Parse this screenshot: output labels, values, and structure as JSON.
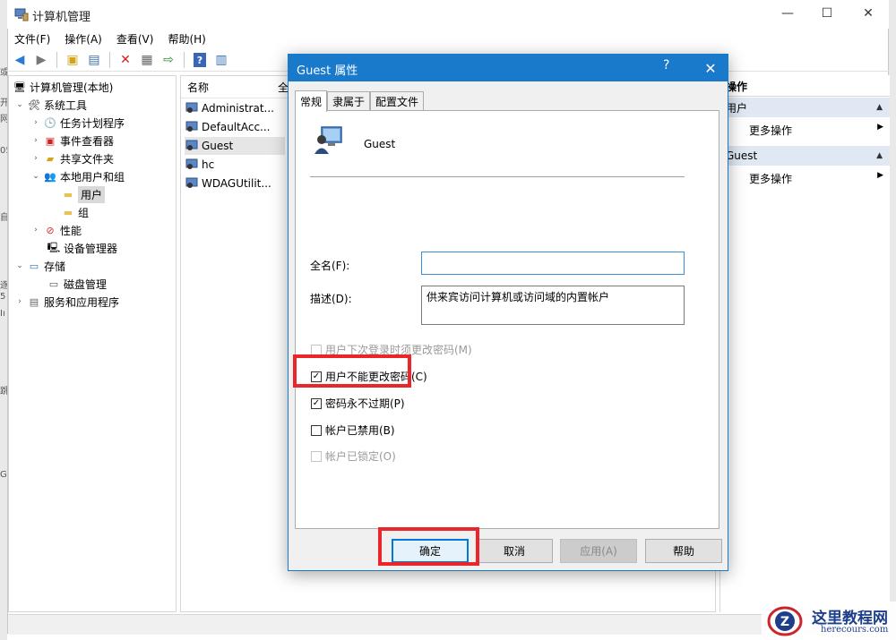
{
  "window": {
    "title": "计算机管理"
  },
  "menu": [
    "文件(F)",
    "操作(A)",
    "查看(V)",
    "帮助(H)"
  ],
  "tree": [
    {
      "label": "计算机管理(本地)",
      "icon": "computer-management-icon"
    },
    {
      "label": "系统工具",
      "icon": "tools-icon",
      "expanded": true
    },
    {
      "label": "任务计划程序",
      "icon": "clock-icon"
    },
    {
      "label": "事件查看器",
      "icon": "event-viewer-icon"
    },
    {
      "label": "共享文件夹",
      "icon": "shared-folder-icon"
    },
    {
      "label": "本地用户和组",
      "icon": "users-group-icon",
      "expanded": true
    },
    {
      "label": "用户",
      "icon": "folder-icon",
      "selected": true
    },
    {
      "label": "组",
      "icon": "folder-icon"
    },
    {
      "label": "性能",
      "icon": "performance-icon"
    },
    {
      "label": "设备管理器",
      "icon": "device-manager-icon"
    },
    {
      "label": "存储",
      "icon": "storage-icon",
      "expanded": true
    },
    {
      "label": "磁盘管理",
      "icon": "disk-icon"
    },
    {
      "label": "服务和应用程序",
      "icon": "services-icon"
    }
  ],
  "list": {
    "columns": [
      "名称",
      "全"
    ],
    "rows": [
      "Administrat...",
      "DefaultAcc...",
      "Guest",
      "hc",
      "WDAGUtilit..."
    ],
    "selected_row": "Guest"
  },
  "actions": {
    "header": "操作",
    "sections": [
      {
        "title": "用户",
        "item": "更多操作"
      },
      {
        "title": "Guest",
        "item": "更多操作"
      }
    ]
  },
  "left_strip_fragments": [
    "或",
    "开",
    "网",
    "05",
    "自",
    "逐",
    "5",
    "Iı",
    "跳",
    "Gl"
  ],
  "dialog": {
    "title": "Guest 属性",
    "help": "?",
    "close": "✕",
    "tabs": [
      "常规",
      "隶属于",
      "配置文件"
    ],
    "active_tab": "常规",
    "username": "Guest",
    "full_name_label": "全名(F):",
    "full_name_value": "",
    "description_label": "描述(D):",
    "description_value": "供来宾访问计算机或访问域的内置帐户",
    "checkboxes": [
      {
        "label": "用户下次登录时须更改密码(M)",
        "checked": false,
        "disabled": true
      },
      {
        "label": "用户不能更改密码(C)",
        "checked": true,
        "disabled": false
      },
      {
        "label": "密码永不过期(P)",
        "checked": true,
        "disabled": false
      },
      {
        "label": "帐户已禁用(B)",
        "checked": false,
        "disabled": false
      },
      {
        "label": "帐户已锁定(O)",
        "checked": false,
        "disabled": true
      }
    ],
    "buttons": {
      "ok": "确定",
      "cancel": "取消",
      "apply": "应用(A)",
      "help": "帮助"
    }
  },
  "watermark": {
    "name": "这里教程网",
    "url": "herecours.com"
  },
  "colors": {
    "dialog_blue": "#1979ca",
    "highlight_red": "#e8262b",
    "action_header": "#dfe8f3"
  }
}
